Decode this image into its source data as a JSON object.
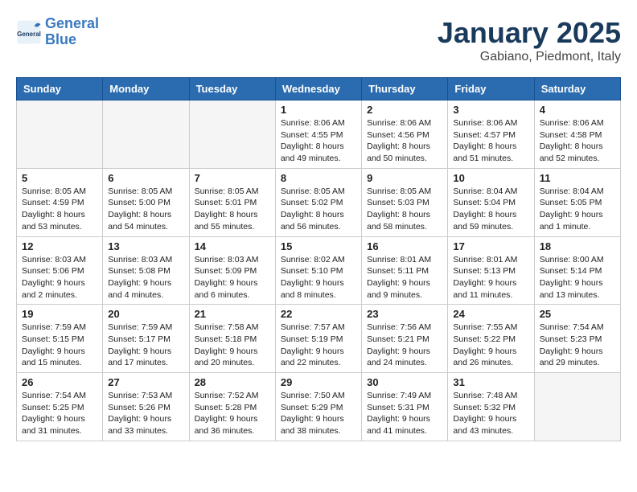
{
  "logo": {
    "line1": "General",
    "line2": "Blue"
  },
  "header": {
    "month": "January 2025",
    "location": "Gabiano, Piedmont, Italy"
  },
  "weekdays": [
    "Sunday",
    "Monday",
    "Tuesday",
    "Wednesday",
    "Thursday",
    "Friday",
    "Saturday"
  ],
  "weeks": [
    [
      {
        "day": "",
        "info": "",
        "empty": true
      },
      {
        "day": "",
        "info": "",
        "empty": true
      },
      {
        "day": "",
        "info": "",
        "empty": true
      },
      {
        "day": "1",
        "info": "Sunrise: 8:06 AM\nSunset: 4:55 PM\nDaylight: 8 hours\nand 49 minutes."
      },
      {
        "day": "2",
        "info": "Sunrise: 8:06 AM\nSunset: 4:56 PM\nDaylight: 8 hours\nand 50 minutes."
      },
      {
        "day": "3",
        "info": "Sunrise: 8:06 AM\nSunset: 4:57 PM\nDaylight: 8 hours\nand 51 minutes."
      },
      {
        "day": "4",
        "info": "Sunrise: 8:06 AM\nSunset: 4:58 PM\nDaylight: 8 hours\nand 52 minutes."
      }
    ],
    [
      {
        "day": "5",
        "info": "Sunrise: 8:05 AM\nSunset: 4:59 PM\nDaylight: 8 hours\nand 53 minutes."
      },
      {
        "day": "6",
        "info": "Sunrise: 8:05 AM\nSunset: 5:00 PM\nDaylight: 8 hours\nand 54 minutes."
      },
      {
        "day": "7",
        "info": "Sunrise: 8:05 AM\nSunset: 5:01 PM\nDaylight: 8 hours\nand 55 minutes."
      },
      {
        "day": "8",
        "info": "Sunrise: 8:05 AM\nSunset: 5:02 PM\nDaylight: 8 hours\nand 56 minutes."
      },
      {
        "day": "9",
        "info": "Sunrise: 8:05 AM\nSunset: 5:03 PM\nDaylight: 8 hours\nand 58 minutes."
      },
      {
        "day": "10",
        "info": "Sunrise: 8:04 AM\nSunset: 5:04 PM\nDaylight: 8 hours\nand 59 minutes."
      },
      {
        "day": "11",
        "info": "Sunrise: 8:04 AM\nSunset: 5:05 PM\nDaylight: 9 hours\nand 1 minute."
      }
    ],
    [
      {
        "day": "12",
        "info": "Sunrise: 8:03 AM\nSunset: 5:06 PM\nDaylight: 9 hours\nand 2 minutes."
      },
      {
        "day": "13",
        "info": "Sunrise: 8:03 AM\nSunset: 5:08 PM\nDaylight: 9 hours\nand 4 minutes."
      },
      {
        "day": "14",
        "info": "Sunrise: 8:03 AM\nSunset: 5:09 PM\nDaylight: 9 hours\nand 6 minutes."
      },
      {
        "day": "15",
        "info": "Sunrise: 8:02 AM\nSunset: 5:10 PM\nDaylight: 9 hours\nand 8 minutes."
      },
      {
        "day": "16",
        "info": "Sunrise: 8:01 AM\nSunset: 5:11 PM\nDaylight: 9 hours\nand 9 minutes."
      },
      {
        "day": "17",
        "info": "Sunrise: 8:01 AM\nSunset: 5:13 PM\nDaylight: 9 hours\nand 11 minutes."
      },
      {
        "day": "18",
        "info": "Sunrise: 8:00 AM\nSunset: 5:14 PM\nDaylight: 9 hours\nand 13 minutes."
      }
    ],
    [
      {
        "day": "19",
        "info": "Sunrise: 7:59 AM\nSunset: 5:15 PM\nDaylight: 9 hours\nand 15 minutes."
      },
      {
        "day": "20",
        "info": "Sunrise: 7:59 AM\nSunset: 5:17 PM\nDaylight: 9 hours\nand 17 minutes."
      },
      {
        "day": "21",
        "info": "Sunrise: 7:58 AM\nSunset: 5:18 PM\nDaylight: 9 hours\nand 20 minutes."
      },
      {
        "day": "22",
        "info": "Sunrise: 7:57 AM\nSunset: 5:19 PM\nDaylight: 9 hours\nand 22 minutes."
      },
      {
        "day": "23",
        "info": "Sunrise: 7:56 AM\nSunset: 5:21 PM\nDaylight: 9 hours\nand 24 minutes."
      },
      {
        "day": "24",
        "info": "Sunrise: 7:55 AM\nSunset: 5:22 PM\nDaylight: 9 hours\nand 26 minutes."
      },
      {
        "day": "25",
        "info": "Sunrise: 7:54 AM\nSunset: 5:23 PM\nDaylight: 9 hours\nand 29 minutes."
      }
    ],
    [
      {
        "day": "26",
        "info": "Sunrise: 7:54 AM\nSunset: 5:25 PM\nDaylight: 9 hours\nand 31 minutes."
      },
      {
        "day": "27",
        "info": "Sunrise: 7:53 AM\nSunset: 5:26 PM\nDaylight: 9 hours\nand 33 minutes."
      },
      {
        "day": "28",
        "info": "Sunrise: 7:52 AM\nSunset: 5:28 PM\nDaylight: 9 hours\nand 36 minutes."
      },
      {
        "day": "29",
        "info": "Sunrise: 7:50 AM\nSunset: 5:29 PM\nDaylight: 9 hours\nand 38 minutes."
      },
      {
        "day": "30",
        "info": "Sunrise: 7:49 AM\nSunset: 5:31 PM\nDaylight: 9 hours\nand 41 minutes."
      },
      {
        "day": "31",
        "info": "Sunrise: 7:48 AM\nSunset: 5:32 PM\nDaylight: 9 hours\nand 43 minutes."
      },
      {
        "day": "",
        "info": "",
        "empty": true
      }
    ]
  ]
}
